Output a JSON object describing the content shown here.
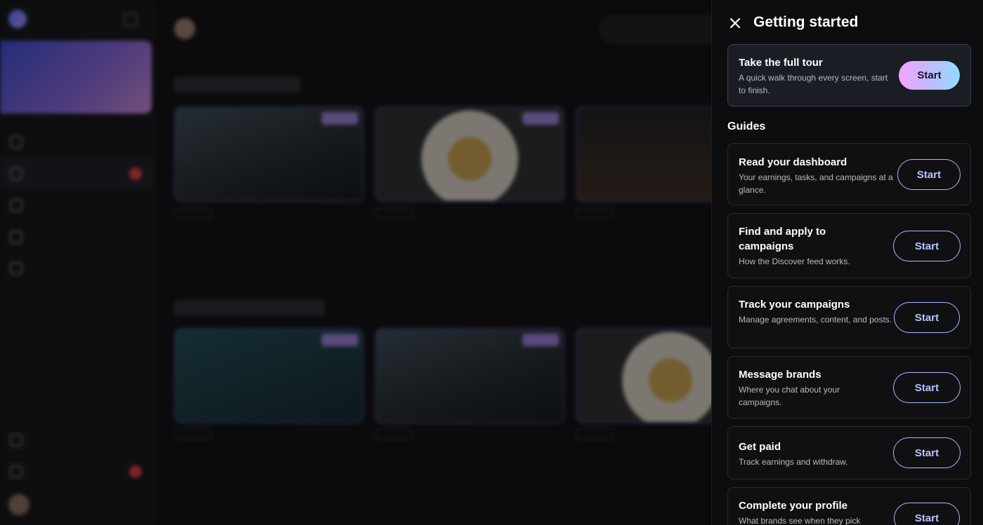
{
  "panel": {
    "title": "Getting started",
    "close_icon": "close-icon",
    "tour": {
      "title": "Take the full tour",
      "description": "A quick walk through every screen, start to finish.",
      "button": "Start"
    },
    "guides_label": "Guides",
    "guides": [
      {
        "title": "Read your dashboard",
        "description": "Your earnings, tasks, and campaigns at a glance.",
        "button": "Start"
      },
      {
        "title": "Find and apply to campaigns",
        "description": "How the Discover feed works.",
        "button": "Start"
      },
      {
        "title": "Track your campaigns",
        "description": "Manage agreements, content, and posts.",
        "button": "Start"
      },
      {
        "title": "Message brands",
        "description": "Where you chat about your campaigns.",
        "button": "Start"
      },
      {
        "title": "Get paid",
        "description": "Track earnings and withdraw.",
        "button": "Start"
      },
      {
        "title": "Complete your profile",
        "description": "What brands see when they pick",
        "button": "Start"
      }
    ]
  },
  "colors": {
    "accent": "#6f86ff",
    "button_border": "#a9b7ff",
    "primary_gradient_start": "#f3a6ff",
    "primary_gradient_end": "#8fdcff"
  }
}
